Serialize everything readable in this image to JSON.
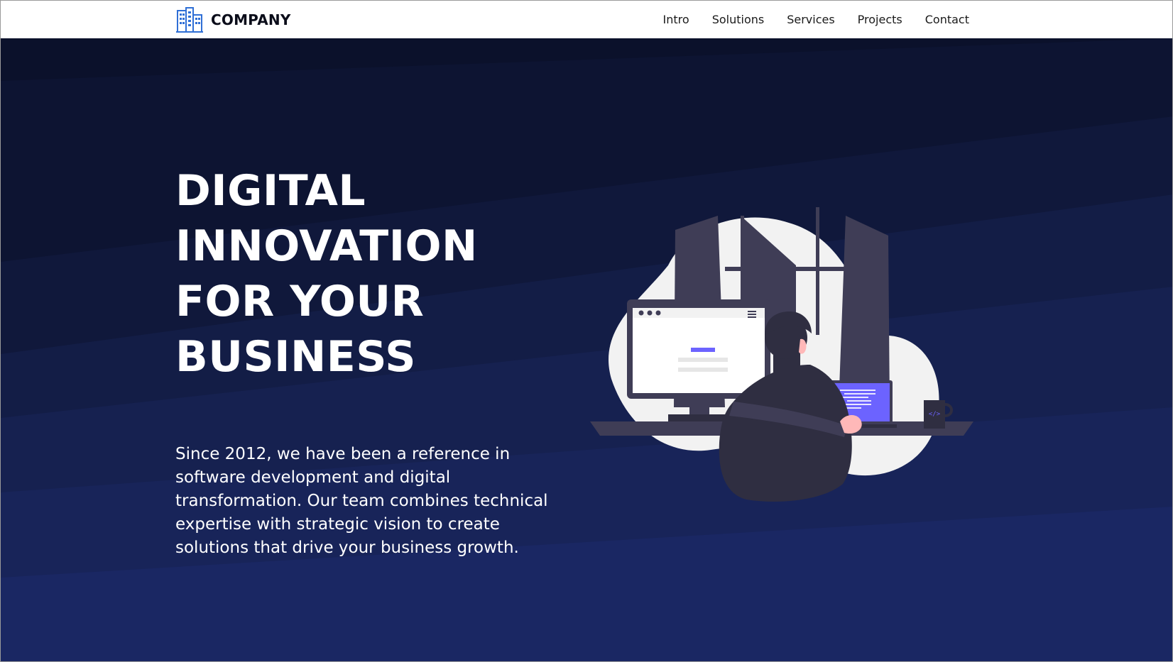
{
  "header": {
    "brand_name": "COMPANY",
    "brand_icon": "building-icon",
    "nav": [
      {
        "label": "Intro"
      },
      {
        "label": "Solutions"
      },
      {
        "label": "Services"
      },
      {
        "label": "Projects"
      },
      {
        "label": "Contact"
      }
    ]
  },
  "hero": {
    "headline_lines": [
      "DIGITAL",
      "INNOVATION",
      "FOR YOUR",
      "BUSINESS"
    ],
    "lead": "Since 2012, we have been a reference in software development and digital transformation. Our team combines technical expertise with strategic vision to create solutions that drive your business growth.",
    "illustration": "developer-at-desk-illustration"
  },
  "colors": {
    "header_bg": "#ffffff",
    "brand_icon": "#2f6fd6",
    "hero_dark": "#0b1230",
    "hero_light": "#1a2763",
    "text_light": "#ffffff",
    "accent": "#6c63ff",
    "figure_dark": "#3f3d56",
    "blob": "#f2f2f2"
  }
}
